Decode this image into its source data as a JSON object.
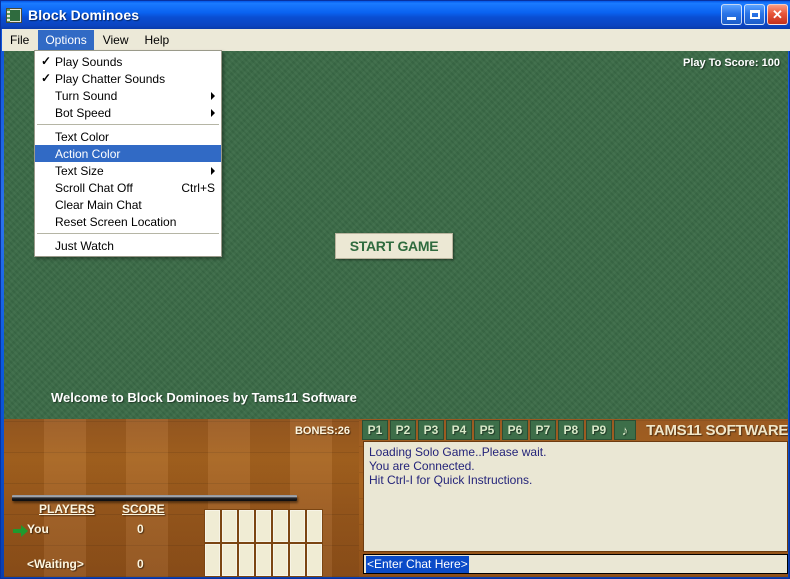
{
  "window": {
    "title": "Block Dominoes",
    "icon": "app-grid-icon",
    "buttons": {
      "minimize": "minimize-icon",
      "maximize": "maximize-icon",
      "close": "✕"
    }
  },
  "menubar": {
    "items": [
      {
        "label": "File",
        "active": false
      },
      {
        "label": "Options",
        "active": true
      },
      {
        "label": "View",
        "active": false
      },
      {
        "label": "Help",
        "active": false
      }
    ]
  },
  "dropdown": {
    "owner": "Options",
    "items": [
      {
        "label": "Play Sounds",
        "checked": true,
        "submenu": false,
        "accel": "",
        "selected": false,
        "separator_after": false
      },
      {
        "label": "Play Chatter Sounds",
        "checked": true,
        "submenu": false,
        "accel": "",
        "selected": false,
        "separator_after": false
      },
      {
        "label": "Turn Sound",
        "checked": false,
        "submenu": true,
        "accel": "",
        "selected": false,
        "separator_after": false
      },
      {
        "label": "Bot Speed",
        "checked": false,
        "submenu": true,
        "accel": "",
        "selected": false,
        "separator_after": true
      },
      {
        "label": "Text Color",
        "checked": false,
        "submenu": false,
        "accel": "",
        "selected": false,
        "separator_after": false
      },
      {
        "label": "Action Color",
        "checked": false,
        "submenu": false,
        "accel": "",
        "selected": true,
        "separator_after": false
      },
      {
        "label": "Text Size",
        "checked": false,
        "submenu": true,
        "accel": "",
        "selected": false,
        "separator_after": false
      },
      {
        "label": "Scroll Chat Off",
        "checked": false,
        "submenu": false,
        "accel": "Ctrl+S",
        "selected": false,
        "separator_after": false
      },
      {
        "label": "Clear Main Chat",
        "checked": false,
        "submenu": false,
        "accel": "",
        "selected": false,
        "separator_after": false
      },
      {
        "label": "Reset Screen Location",
        "checked": false,
        "submenu": false,
        "accel": "",
        "selected": false,
        "separator_after": true
      },
      {
        "label": "Just Watch",
        "checked": false,
        "submenu": false,
        "accel": "",
        "selected": false,
        "separator_after": false
      }
    ]
  },
  "table": {
    "play_to_score": "Play To Score: 100",
    "start_button": "START GAME",
    "welcome": "Welcome to Block Dominoes by Tams11 Software"
  },
  "players_panel": {
    "bones": "BONES:26",
    "col_players": "PLAYERS",
    "col_score": "SCORE",
    "turn_indicator": "green-arrow-icon",
    "rows": [
      {
        "name": "You",
        "score": "0",
        "turn": true
      },
      {
        "name": "<Waiting>",
        "score": "0",
        "turn": false
      }
    ],
    "hand_tiles": 14
  },
  "chat_panel": {
    "tabs": [
      "P1",
      "P2",
      "P3",
      "P4",
      "P5",
      "P6",
      "P7",
      "P8",
      "P9"
    ],
    "note_tab": "♪",
    "brand": "TAMS11 SOFTWARE",
    "log": [
      "Loading Solo Game..Please wait.",
      "You are Connected.",
      "Hit Ctrl-I for Quick Instructions."
    ],
    "input_value": "<Enter Chat Here>"
  },
  "colors": {
    "felt_green": "#3b6b47",
    "wood_brown": "#a8641f",
    "chat_cream": "#eae7d4",
    "chat_text": "#24247a",
    "menu_highlight": "#316ac5",
    "title_blue": "#0a4ed2",
    "tile_cream": "#f0ecd4",
    "tab_green": "#3d6e49",
    "brand_cream": "#f0e6c8",
    "arrow_green": "#1f9a2e"
  }
}
